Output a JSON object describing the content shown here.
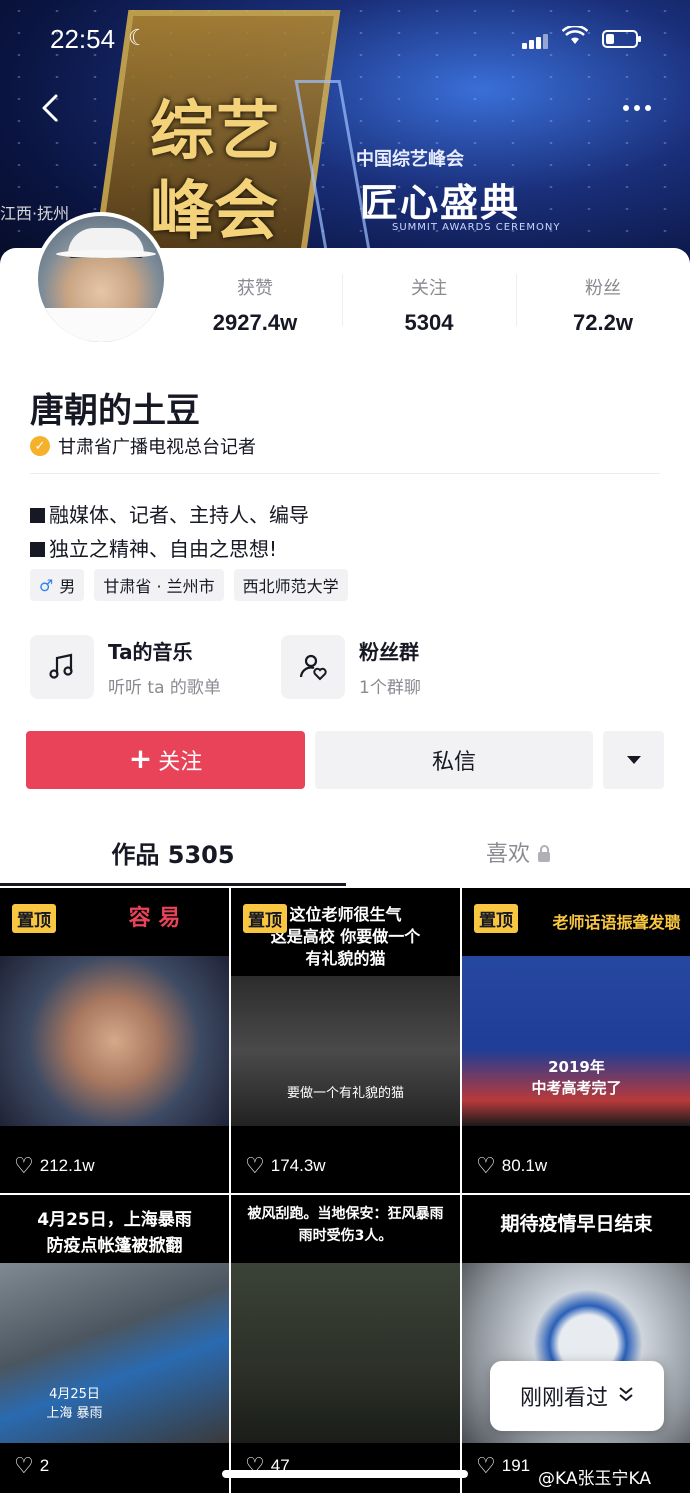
{
  "status_bar": {
    "time": "22:54"
  },
  "banner": {
    "line1": "综艺",
    "line2": "峰会",
    "summit_cn": "中国综艺峰会",
    "craft": "匠心盛典",
    "summit_en": "SUMMIT AWARDS CEREMONY",
    "city": "江西·抚州"
  },
  "profile": {
    "name": "唐朝的土豆",
    "verification": "甘肃省广播电视总台记者",
    "stats": [
      {
        "label": "获赞",
        "value": "2927.4w"
      },
      {
        "label": "关注",
        "value": "5304"
      },
      {
        "label": "粉丝",
        "value": "72.2w"
      }
    ],
    "bio": [
      "融媒体、记者、主持人、编导",
      "独立之精神、自由之思想!"
    ],
    "tags": {
      "gender_symbol": "♂",
      "gender": "男",
      "location": "甘肃省 · 兰州市",
      "school": "西北师范大学"
    },
    "services": [
      {
        "title": "Ta的音乐",
        "subtitle": "听听 ta 的歌单",
        "icon": "music-note-icon"
      },
      {
        "title": "粉丝群",
        "subtitle": "1个群聊",
        "icon": "fan-group-icon"
      }
    ]
  },
  "actions": {
    "follow_plus": "+",
    "follow": "关注",
    "message": "私信"
  },
  "tabs": {
    "works": "作品 5305",
    "likes": "喜欢"
  },
  "videos": [
    {
      "pinned": "置顶",
      "caption": "容 易",
      "likes": "212.1w"
    },
    {
      "pinned": "置顶",
      "caption": "这位老师很生气\n这是高校 你要做一个\n有礼貌的猫",
      "sub": "要做一个有礼貌的猫",
      "likes": "174.3w"
    },
    {
      "pinned": "置顶",
      "caption": "老师话语振聋发聩",
      "sub": "2019年\n中考高考完了",
      "likes": "80.1w"
    },
    {
      "caption": "4月25日，上海暴雨\n防疫点帐篷被掀翻",
      "sub": "4月25日\n上海 暴雨",
      "likes": "2"
    },
    {
      "caption": "被风刮跑。当地保安：狂风暴雨\n雨时受伤3人。",
      "likes": "47"
    },
    {
      "caption": "期待疫情早日结束",
      "likes": "191"
    }
  ],
  "floating": {
    "just_seen": "刚刚看过"
  },
  "watermark": "@KA张玉宁KA",
  "colors": {
    "follow": "#e94359",
    "pin": "#f8c640",
    "verify": "#f5b12a",
    "male": "#2a84f6"
  }
}
